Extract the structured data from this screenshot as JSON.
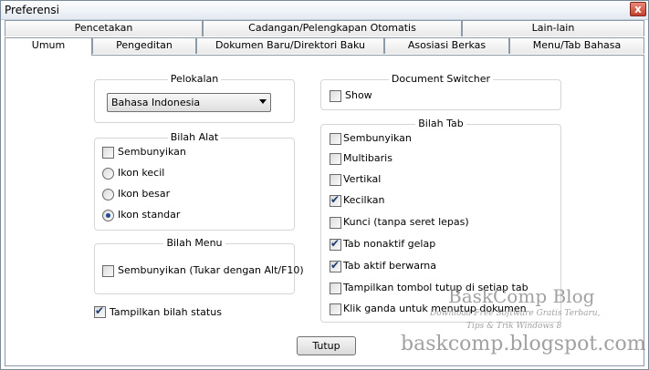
{
  "window": {
    "title": "Preferensi",
    "close_glyph": "x"
  },
  "tabs_row1": [
    {
      "label": "Pencetakan"
    },
    {
      "label": "Cadangan/Pelengkapan Otomatis"
    },
    {
      "label": "Lain-lain"
    }
  ],
  "tabs_row2": [
    {
      "label": "Umum",
      "active": true
    },
    {
      "label": "Pengeditan"
    },
    {
      "label": "Dokumen Baru/Direktori Baku"
    },
    {
      "label": "Asosiasi Berkas"
    },
    {
      "label": "Menu/Tab Bahasa"
    }
  ],
  "localization": {
    "label": "Pelokalan",
    "selected": "Bahasa Indonesia"
  },
  "toolbar": {
    "label": "Bilah Alat",
    "hide_label": "Sembunyikan",
    "hide_checked": false,
    "radios": [
      {
        "label": "Ikon kecil",
        "checked": false
      },
      {
        "label": "Ikon besar",
        "checked": false
      },
      {
        "label": "Ikon standar",
        "checked": true
      }
    ]
  },
  "menubar": {
    "label": "Bilah Menu",
    "hide_label": "Sembunyikan (Tukar dengan Alt/F10)",
    "hide_checked": false
  },
  "statusbar": {
    "label": "Tampilkan bilah status",
    "checked": true
  },
  "doc_switcher": {
    "label": "Document Switcher",
    "show_label": "Show",
    "show_checked": false
  },
  "tabbar": {
    "label": "Bilah Tab",
    "options": [
      {
        "label": "Sembunyikan",
        "checked": false
      },
      {
        "label": "Multibaris",
        "checked": false
      },
      {
        "label": "Vertikal",
        "checked": false
      },
      {
        "label": "Kecilkan",
        "checked": true
      },
      {
        "label": "Kunci (tanpa seret lepas)",
        "checked": false
      },
      {
        "label": "Tab nonaktif gelap",
        "checked": true
      },
      {
        "label": "Tab aktif berwarna",
        "checked": true
      },
      {
        "label": "Tampilkan tombol tutup di setiap tab",
        "checked": false
      },
      {
        "label": "Klik ganda untuk menutup dokumen",
        "checked": false
      }
    ]
  },
  "close_button": {
    "label": "Tutup"
  },
  "watermark": {
    "brand": "BaskComp Blog",
    "line1": "Download Free Software Gratis Terbaru,",
    "line2": "Tips & Trik Windows 8",
    "url": "baskcomp.blogspot.com"
  }
}
